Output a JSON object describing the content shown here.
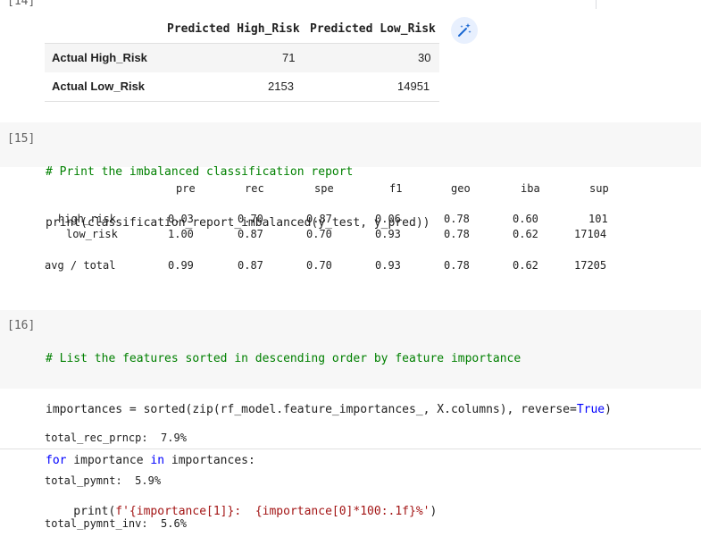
{
  "top_prompt": "[14]",
  "dataframe": {
    "columns": [
      "Predicted High_Risk",
      "Predicted Low_Risk"
    ],
    "rows": [
      {
        "label": "Actual High_Risk",
        "values": [
          "71",
          "30"
        ]
      },
      {
        "label": "Actual Low_Risk",
        "values": [
          "2153",
          "14951"
        ]
      }
    ]
  },
  "cell15": {
    "prompt": "[15]",
    "line1": "# Print the imbalanced classification report",
    "line2_parts": [
      "print(classification_report_imbalanced(y_test, y_pred))"
    ]
  },
  "report": {
    "headers": [
      "pre",
      "rec",
      "spe",
      "f1",
      "geo",
      "iba",
      "sup"
    ],
    "rows": [
      {
        "label": "high_risk",
        "values": [
          "0.03",
          "0.70",
          "0.87",
          "0.06",
          "0.78",
          "0.60",
          "101"
        ]
      },
      {
        "label": "low_risk",
        "values": [
          "1.00",
          "0.87",
          "0.70",
          "0.93",
          "0.78",
          "0.62",
          "17104"
        ]
      },
      {
        "label": "avg / total",
        "values": [
          "0.99",
          "0.87",
          "0.70",
          "0.93",
          "0.78",
          "0.62",
          "17205"
        ]
      }
    ]
  },
  "cell16": {
    "prompt": "[16]",
    "line1": "# List the features sorted in descending order by feature importance",
    "line2_a": "importances = sorted(zip(rf_model.feature_importances_, X.columns), reverse=",
    "line2_b": "True",
    "line2_c": ")",
    "line3_a": "for",
    "line3_b": " importance ",
    "line3_c": "in",
    "line3_d": " importances:",
    "line4_a": "    print(",
    "line4_b": "f'{importance[1]}:  {importance[0]*100:.1f}%'",
    "line4_c": ")"
  },
  "output16": [
    "total_rec_prncp:  7.9%",
    "total_pymnt:  5.9%",
    "total_pymnt_inv:  5.6%"
  ],
  "icons": {
    "wand": "magic-wand-icon"
  }
}
